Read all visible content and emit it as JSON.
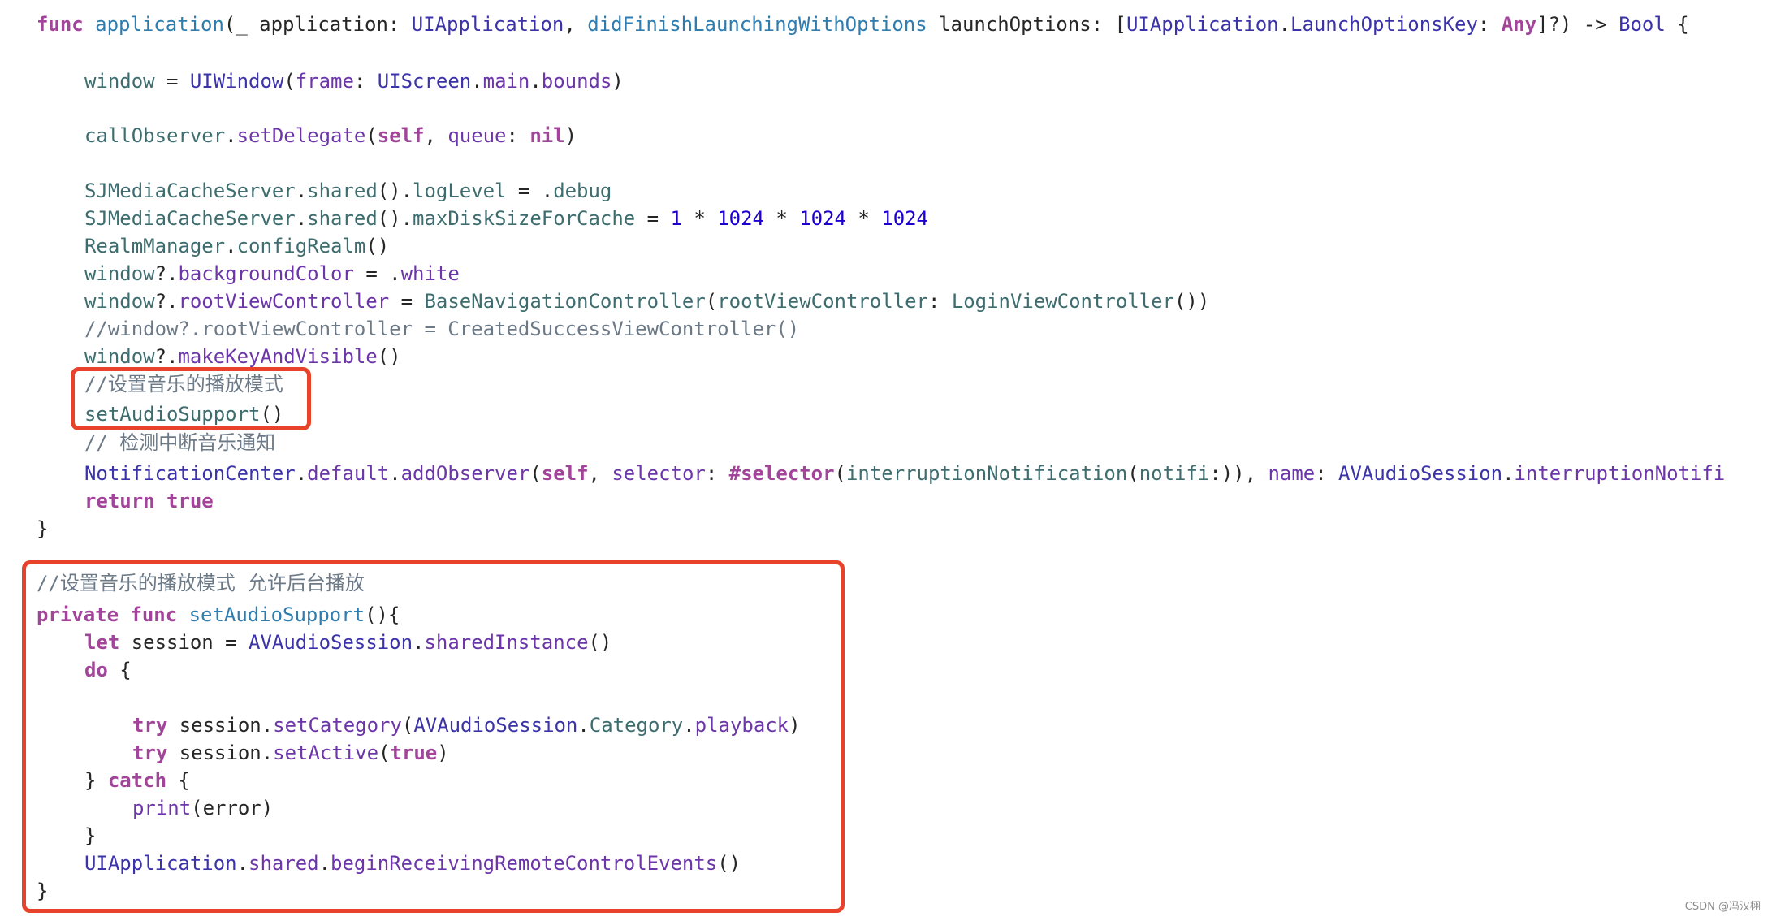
{
  "editor": {
    "language": "swift",
    "lines": [
      {
        "indent": 0,
        "tokens": [
          [
            "kw",
            "func"
          ],
          [
            "plain",
            " "
          ],
          [
            "decl",
            "application"
          ],
          [
            "plain",
            "(_ application: "
          ],
          [
            "type",
            "UIApplication"
          ],
          [
            "plain",
            ", "
          ],
          [
            "decl",
            "didFinishLaunchingWithOptions"
          ],
          [
            "plain",
            " launchOptions: ["
          ],
          [
            "type",
            "UIApplication"
          ],
          [
            "plain",
            "."
          ],
          [
            "type",
            "LaunchOptionsKey"
          ],
          [
            "plain",
            ": "
          ],
          [
            "kw",
            "Any"
          ],
          [
            "plain",
            "]?) -> "
          ],
          [
            "type",
            "Bool"
          ],
          [
            "plain",
            " {"
          ]
        ]
      },
      {
        "indent": 1,
        "tokens": [
          [
            "proj",
            "window"
          ],
          [
            "plain",
            " = "
          ],
          [
            "type",
            "UIWindow"
          ],
          [
            "plain",
            "("
          ],
          [
            "mem",
            "frame"
          ],
          [
            "plain",
            ": "
          ],
          [
            "type",
            "UIScreen"
          ],
          [
            "plain",
            "."
          ],
          [
            "mem",
            "main"
          ],
          [
            "plain",
            "."
          ],
          [
            "mem",
            "bounds"
          ],
          [
            "plain",
            ")"
          ]
        ]
      },
      {
        "indent": 1,
        "tokens": [
          [
            "proj",
            "callObserver"
          ],
          [
            "plain",
            "."
          ],
          [
            "mem",
            "setDelegate"
          ],
          [
            "plain",
            "("
          ],
          [
            "kw",
            "self"
          ],
          [
            "plain",
            ", "
          ],
          [
            "mem",
            "queue"
          ],
          [
            "plain",
            ": "
          ],
          [
            "kw",
            "nil"
          ],
          [
            "plain",
            ")"
          ]
        ]
      },
      {
        "indent": 1,
        "tokens": [
          [
            "proj",
            "SJMediaCacheServer"
          ],
          [
            "plain",
            "."
          ],
          [
            "proj",
            "shared"
          ],
          [
            "plain",
            "()."
          ],
          [
            "proj",
            "logLevel"
          ],
          [
            "plain",
            " = ."
          ],
          [
            "proj",
            "debug"
          ]
        ]
      },
      {
        "indent": 1,
        "tokens": [
          [
            "proj",
            "SJMediaCacheServer"
          ],
          [
            "plain",
            "."
          ],
          [
            "proj",
            "shared"
          ],
          [
            "plain",
            "()."
          ],
          [
            "proj",
            "maxDiskSizeForCache"
          ],
          [
            "plain",
            " = "
          ],
          [
            "num",
            "1"
          ],
          [
            "plain",
            " * "
          ],
          [
            "num",
            "1024"
          ],
          [
            "plain",
            " * "
          ],
          [
            "num",
            "1024"
          ],
          [
            "plain",
            " * "
          ],
          [
            "num",
            "1024"
          ]
        ]
      },
      {
        "indent": 1,
        "tokens": [
          [
            "proj",
            "RealmManager"
          ],
          [
            "plain",
            "."
          ],
          [
            "proj",
            "configRealm"
          ],
          [
            "plain",
            "()"
          ]
        ]
      },
      {
        "indent": 1,
        "tokens": [
          [
            "proj",
            "window"
          ],
          [
            "plain",
            "?."
          ],
          [
            "mem",
            "backgroundColor"
          ],
          [
            "plain",
            " = ."
          ],
          [
            "mem",
            "white"
          ]
        ]
      },
      {
        "indent": 1,
        "tokens": [
          [
            "proj",
            "window"
          ],
          [
            "plain",
            "?."
          ],
          [
            "mem",
            "rootViewController"
          ],
          [
            "plain",
            " = "
          ],
          [
            "proj",
            "BaseNavigationController"
          ],
          [
            "plain",
            "("
          ],
          [
            "proj",
            "rootViewController"
          ],
          [
            "plain",
            ": "
          ],
          [
            "proj",
            "LoginViewController"
          ],
          [
            "plain",
            "())"
          ]
        ]
      },
      {
        "indent": 1,
        "tokens": [
          [
            "cmt",
            "//window?.rootViewController = CreatedSuccessViewController()"
          ]
        ]
      },
      {
        "indent": 1,
        "tokens": [
          [
            "proj",
            "window"
          ],
          [
            "plain",
            "?."
          ],
          [
            "mem",
            "makeKeyAndVisible"
          ],
          [
            "plain",
            "()"
          ]
        ]
      },
      {
        "indent": 1,
        "tokens": [
          [
            "cmt",
            "//"
          ],
          [
            "cmt-cjk",
            "设置音乐的播放模式"
          ]
        ]
      },
      {
        "indent": 1,
        "tokens": [
          [
            "proj",
            "setAudioSupport"
          ],
          [
            "plain",
            "()"
          ]
        ]
      },
      {
        "indent": 1,
        "tokens": [
          [
            "cmt",
            "// "
          ],
          [
            "cmt-cjk",
            "检测中断音乐通知"
          ]
        ]
      },
      {
        "indent": 1,
        "tokens": [
          [
            "type",
            "NotificationCenter"
          ],
          [
            "plain",
            "."
          ],
          [
            "mem",
            "default"
          ],
          [
            "plain",
            "."
          ],
          [
            "mem",
            "addObserver"
          ],
          [
            "plain",
            "("
          ],
          [
            "kw",
            "self"
          ],
          [
            "plain",
            ", "
          ],
          [
            "mem",
            "selector"
          ],
          [
            "plain",
            ": "
          ],
          [
            "kw",
            "#selector"
          ],
          [
            "plain",
            "("
          ],
          [
            "proj",
            "interruptionNotification"
          ],
          [
            "plain",
            "("
          ],
          [
            "proj",
            "notifi"
          ],
          [
            "plain",
            ":)), "
          ],
          [
            "mem",
            "name"
          ],
          [
            "plain",
            ": "
          ],
          [
            "type",
            "AVAudioSession"
          ],
          [
            "plain",
            "."
          ],
          [
            "mem",
            "interruptionNotifi"
          ]
        ]
      },
      {
        "indent": 1,
        "tokens": [
          [
            "kw",
            "return"
          ],
          [
            "plain",
            " "
          ],
          [
            "kw",
            "true"
          ]
        ]
      },
      {
        "indent": 0,
        "tokens": [
          [
            "plain",
            "}"
          ]
        ]
      },
      {
        "indent": 0,
        "tokens": [
          [
            "cmt",
            "//"
          ],
          [
            "cmt-cjk",
            "设置音乐的播放模式  允许后台播放"
          ]
        ]
      },
      {
        "indent": 0,
        "tokens": [
          [
            "kw",
            "private"
          ],
          [
            "plain",
            " "
          ],
          [
            "kw",
            "func"
          ],
          [
            "plain",
            " "
          ],
          [
            "decl",
            "setAudioSupport"
          ],
          [
            "plain",
            "(){"
          ]
        ]
      },
      {
        "indent": 1,
        "tokens": [
          [
            "kw",
            "let"
          ],
          [
            "plain",
            " session = "
          ],
          [
            "type",
            "AVAudioSession"
          ],
          [
            "plain",
            "."
          ],
          [
            "mem",
            "sharedInstance"
          ],
          [
            "plain",
            "()"
          ]
        ]
      },
      {
        "indent": 1,
        "tokens": [
          [
            "kw",
            "do"
          ],
          [
            "plain",
            " {"
          ]
        ]
      },
      {
        "indent": 2,
        "tokens": [
          [
            "kw",
            "try"
          ],
          [
            "plain",
            " session."
          ],
          [
            "mem",
            "setCategory"
          ],
          [
            "plain",
            "("
          ],
          [
            "type",
            "AVAudioSession"
          ],
          [
            "plain",
            "."
          ],
          [
            "proj",
            "Category"
          ],
          [
            "plain",
            "."
          ],
          [
            "mem",
            "playback"
          ],
          [
            "plain",
            ")"
          ]
        ]
      },
      {
        "indent": 2,
        "tokens": [
          [
            "kw",
            "try"
          ],
          [
            "plain",
            " session."
          ],
          [
            "mem",
            "setActive"
          ],
          [
            "plain",
            "("
          ],
          [
            "kw",
            "true"
          ],
          [
            "plain",
            ")"
          ]
        ]
      },
      {
        "indent": 1,
        "tokens": [
          [
            "plain",
            "} "
          ],
          [
            "kw",
            "catch"
          ],
          [
            "plain",
            " {"
          ]
        ]
      },
      {
        "indent": 2,
        "tokens": [
          [
            "mem",
            "print"
          ],
          [
            "plain",
            "(error)"
          ]
        ]
      },
      {
        "indent": 1,
        "tokens": [
          [
            "plain",
            "}"
          ]
        ]
      },
      {
        "indent": 1,
        "tokens": [
          [
            "type",
            "UIApplication"
          ],
          [
            "plain",
            "."
          ],
          [
            "mem",
            "shared"
          ],
          [
            "plain",
            "."
          ],
          [
            "mem",
            "beginReceivingRemoteControlEvents"
          ],
          [
            "plain",
            "()"
          ]
        ]
      },
      {
        "indent": 0,
        "tokens": [
          [
            "plain",
            "}"
          ]
        ]
      }
    ]
  },
  "highlights": [
    {
      "label": "setAudioSupport call",
      "color": "#e8432a"
    },
    {
      "label": "setAudioSupport definition",
      "color": "#e8432a"
    }
  ],
  "colors": {
    "keyword": "#a2449a",
    "declaration": "#2f7cae",
    "type": "#3b33a8",
    "project_identifier": "#3e6d6f",
    "member": "#6c36a9",
    "number": "#1c00cf",
    "comment": "#6c7986",
    "plain": "#262626",
    "highlight_box": "#e8432a"
  },
  "watermark": "CSDN @冯汉栩"
}
